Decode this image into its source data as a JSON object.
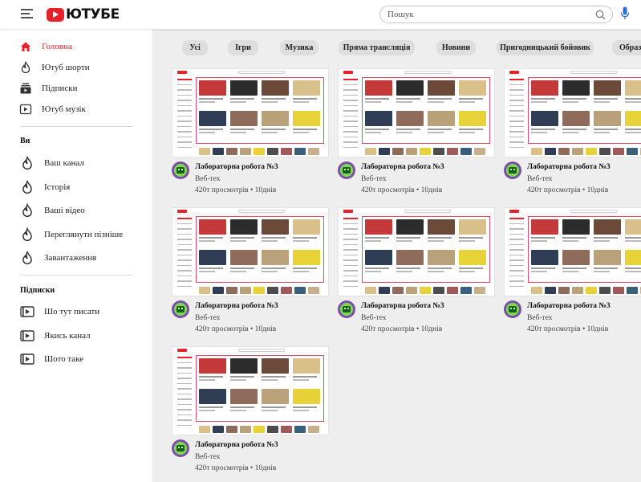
{
  "header": {
    "menu_icon": "hamburger-menu-icon",
    "logo_text": "ЮТУБЕ",
    "search_placeholder": "Пошук",
    "search_icon": "search-icon",
    "mic_icon": "microphone-icon"
  },
  "colors": {
    "accent": "#e8202a",
    "main_bg": "#eeeeee",
    "chip_bg": "#dedede"
  },
  "sidebar": {
    "primary": [
      {
        "label": "Головна",
        "icon": "home-icon",
        "active": true
      },
      {
        "label": "Ютуб шорти",
        "icon": "flame-icon",
        "active": false
      },
      {
        "label": "Підписки",
        "icon": "subscriptions-icon",
        "active": false
      },
      {
        "label": "Ютуб музік",
        "icon": "music-play-icon",
        "active": false
      }
    ],
    "you_title": "Ви",
    "you": [
      {
        "label": "Ваш канал",
        "icon": "flame-icon"
      },
      {
        "label": "Історія",
        "icon": "flame-icon"
      },
      {
        "label": "Ваші відео",
        "icon": "flame-icon"
      },
      {
        "label": "Переглянути пізніше",
        "icon": "flame-icon"
      },
      {
        "label": "Завантаження",
        "icon": "flame-icon"
      }
    ],
    "subs_title": "Підписки",
    "subs": [
      {
        "label": "Шо тут писати",
        "icon": "video-play-icon"
      },
      {
        "label": "Якись канал",
        "icon": "video-play-icon"
      },
      {
        "label": "Шото таке",
        "icon": "video-play-icon"
      }
    ]
  },
  "chips": [
    "Усі",
    "Ігри",
    "Музика",
    "Пряма трансляція",
    "Новини",
    "Пригодницький бойовик",
    "Образ"
  ],
  "videos": [
    {
      "title": "Лабораторна робота №3",
      "channel": "Веб-тех",
      "meta": "420т просмотрів • 10днів"
    },
    {
      "title": "Лабораторна робота №3",
      "channel": "Веб-тех",
      "meta": "420т просмотрів • 10днів"
    },
    {
      "title": "Лабораторна робота №3",
      "channel": "Веб-тех",
      "meta": "420т просмотрів • 10днів"
    },
    {
      "title": "Лабораторна робота №3",
      "channel": "Веб-тех",
      "meta": "420т просмотрів • 10днів"
    },
    {
      "title": "Лабораторна робота №3",
      "channel": "Веб-тех",
      "meta": "420т просмотрів • 10днів"
    },
    {
      "title": "Лабораторна робота №3",
      "channel": "Веб-тех",
      "meta": "420т просмотрів • 10днів"
    },
    {
      "title": "Лабораторна робота №3",
      "channel": "Веб-тех",
      "meta": "420т просмотрів • 10днів"
    }
  ]
}
